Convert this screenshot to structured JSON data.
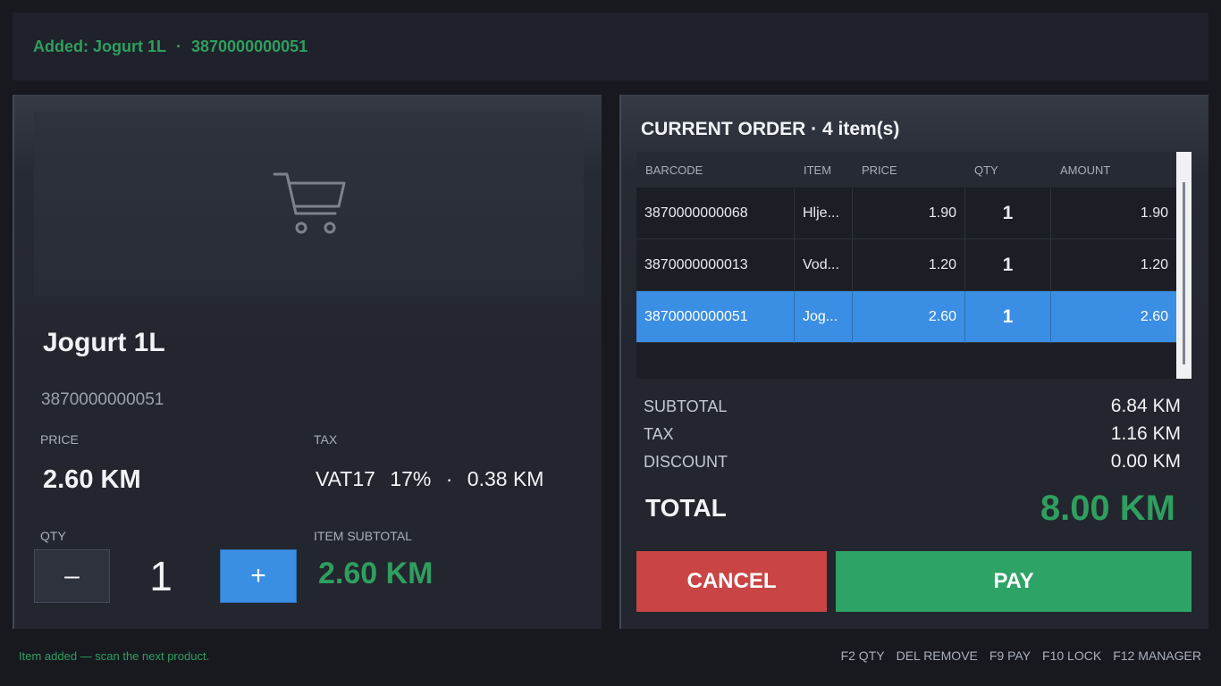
{
  "notification": {
    "prefix": "Added: Jogurt 1L",
    "separator": "·",
    "barcode": "3870000000051",
    "color": "#2f9e5f"
  },
  "product": {
    "image_icon": "shopping-cart-icon",
    "name": "Jogurt 1L",
    "barcode": "3870000000051",
    "price_label": "PRICE",
    "price": "2.60 KM",
    "tax_label": "TAX",
    "tax_code": "VAT17",
    "tax_rate": "17%",
    "tax_sep": "·",
    "tax_amount": "0.38 KM",
    "qty_label": "QTY",
    "qty_minus": "–",
    "qty": "1",
    "qty_plus": "+",
    "subtotal_label": "ITEM SUBTOTAL",
    "subtotal": "2.60 KM"
  },
  "order": {
    "title": "CURRENT ORDER · 4 item(s)",
    "columns": [
      "BARCODE",
      "ITEM",
      "PRICE",
      "QTY",
      "AMOUNT"
    ],
    "rows": [
      {
        "barcode": "3870000000068",
        "item": "Hlje...",
        "price": "1.90",
        "qty": "1",
        "amount": "1.90",
        "selected": false
      },
      {
        "barcode": "3870000000013",
        "item": "Vod...",
        "price": "1.20",
        "qty": "1",
        "amount": "1.20",
        "selected": false
      },
      {
        "barcode": "3870000000051",
        "item": "Jog...",
        "price": "2.60",
        "qty": "1",
        "amount": "2.60",
        "selected": true
      }
    ],
    "summary": {
      "subtotal_label": "SUBTOTAL",
      "subtotal": "6.84 KM",
      "tax_label": "TAX",
      "tax": "1.16 KM",
      "discount_label": "DISCOUNT",
      "discount": "0.00 KM",
      "total_label": "TOTAL",
      "total": "8.00 KM"
    },
    "cancel_label": "CANCEL",
    "pay_label": "PAY"
  },
  "footer": {
    "status": "Item added — scan the next product.",
    "shortcuts": [
      "F2 QTY",
      "DEL REMOVE",
      "F9 PAY",
      "F10 LOCK",
      "F12 MANAGER"
    ]
  },
  "colors": {
    "accent_green": "#2f9e5f",
    "accent_blue": "#3a8ee3",
    "cancel_red": "#c94545",
    "pay_green": "#2ea366"
  }
}
